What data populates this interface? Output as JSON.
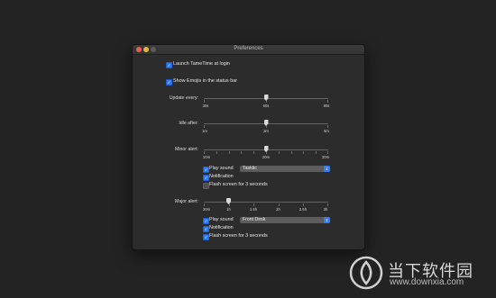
{
  "window": {
    "title": "Preferences"
  },
  "general": {
    "launch_at_login": {
      "label": "Launch TameTime at login",
      "checked": true
    },
    "show_emojis": {
      "label": "Show Emojis in the status bar",
      "checked": true
    }
  },
  "update_every": {
    "label": "Update every:",
    "ticks": [
      "30s",
      "60s",
      "90s"
    ],
    "value_fraction": 0.5
  },
  "idle_after": {
    "label": "Idle after:",
    "ticks": [
      "1m",
      "3m",
      "5m"
    ],
    "value_fraction": 0.5
  },
  "minor_alert": {
    "label": "Minor alert:",
    "ticks": [
      "10m",
      "20m",
      "30m"
    ],
    "value_fraction": 0.5,
    "play_sound": {
      "label": "Play sound",
      "checked": true,
      "sound": "Tasktic"
    },
    "notification": {
      "label": "Notification",
      "checked": true
    },
    "flash_screen": {
      "label": "Flash screen for 3 seconds",
      "checked": false
    }
  },
  "major_alert": {
    "label": "Major alert:",
    "ticks": [
      "30m",
      "1h",
      "1.5h",
      "2h",
      "2.5h",
      "3h"
    ],
    "value_fraction": 0.2,
    "play_sound": {
      "label": "Play sound",
      "checked": true,
      "sound": "Front Desk"
    },
    "notification": {
      "label": "Notification",
      "checked": true
    },
    "flash_screen": {
      "label": "Flash screen for 3 seconds",
      "checked": true
    }
  },
  "watermark": {
    "name": "当下软件园",
    "url": "www.downxia.com"
  },
  "colors": {
    "accent": "#2f7cf6",
    "window_bg": "#2c2c2c",
    "desktop_bg": "#232323"
  }
}
